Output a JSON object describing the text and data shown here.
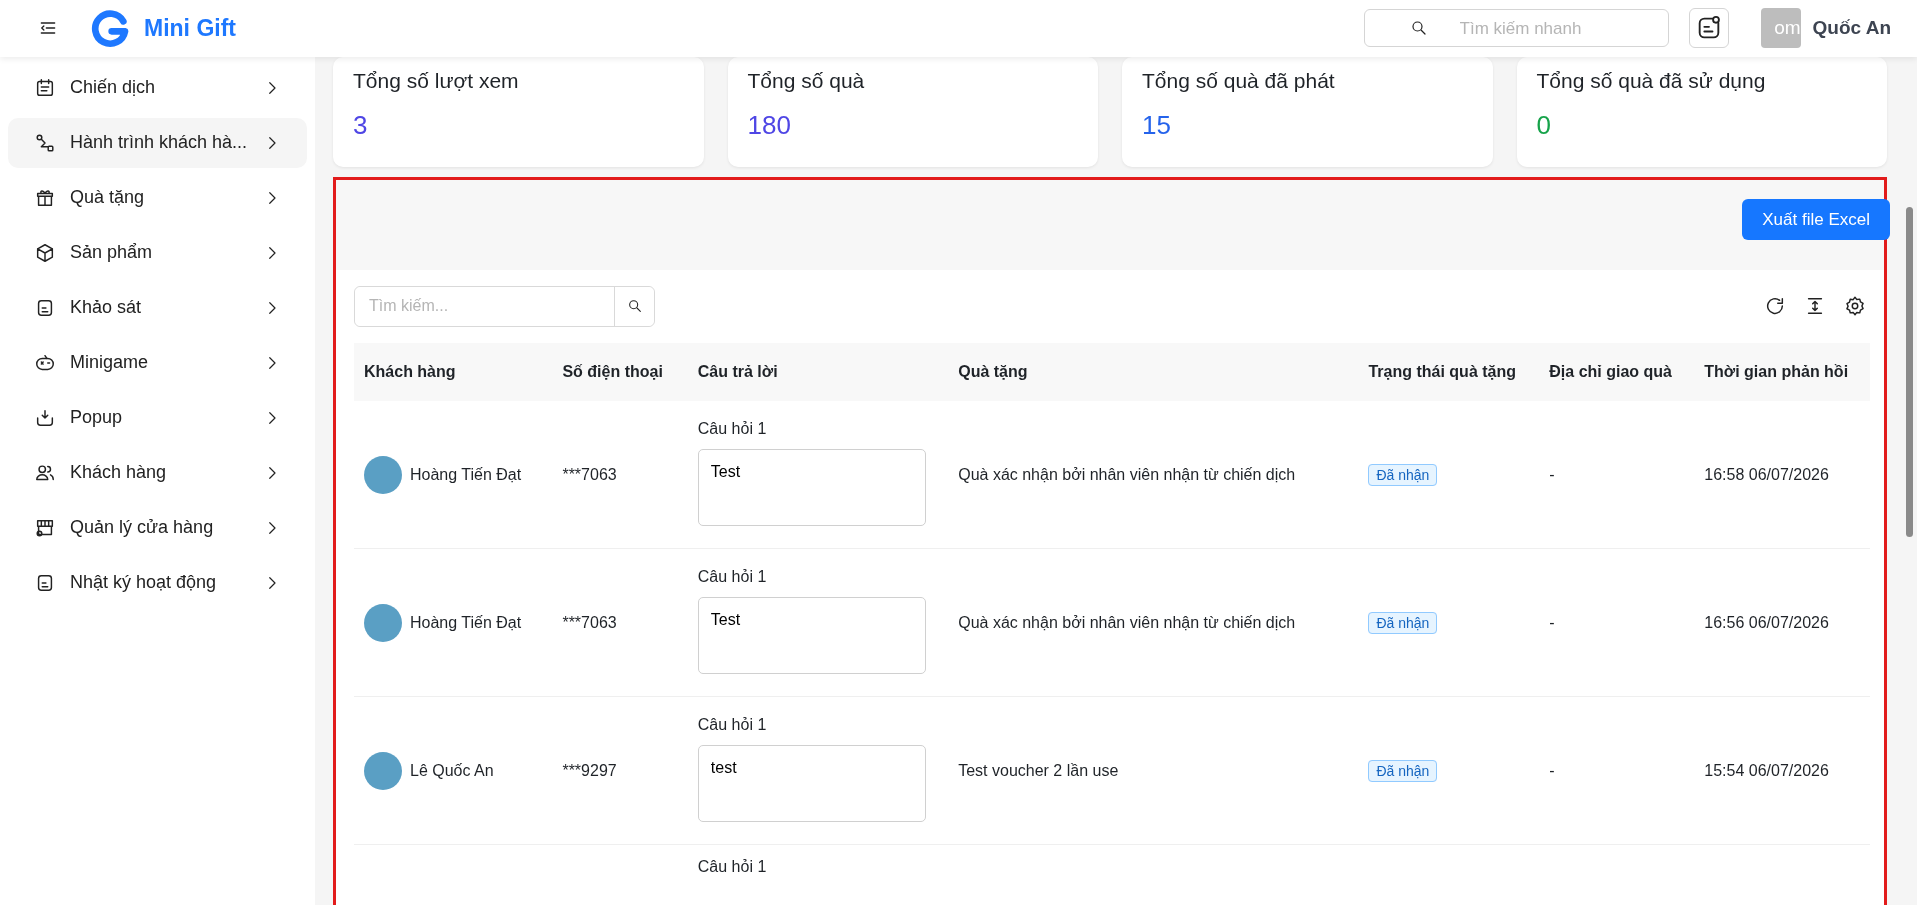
{
  "header": {
    "brand": "Mini Gift",
    "search": {
      "placeholder": "Tìm kiếm nhanh"
    },
    "user": {
      "avatar_text": "om",
      "name": "Quốc An"
    }
  },
  "sidebar": {
    "items": [
      {
        "label": "Chiến dịch",
        "selected": false
      },
      {
        "label": "Hành trình khách hà...",
        "selected": true
      },
      {
        "label": "Quà tặng",
        "selected": false
      },
      {
        "label": "Sản phẩm",
        "selected": false
      },
      {
        "label": "Khảo sát",
        "selected": false
      },
      {
        "label": "Minigame",
        "selected": false
      },
      {
        "label": "Popup",
        "selected": false
      },
      {
        "label": "Khách hàng",
        "selected": false
      },
      {
        "label": "Quản lý cửa hàng",
        "selected": false
      },
      {
        "label": "Nhật ký hoạt động",
        "selected": false
      }
    ]
  },
  "stats": [
    {
      "title": "Tổng số lượt xem",
      "value": "3",
      "color": "#4f46e5"
    },
    {
      "title": "Tổng số quà",
      "value": "180",
      "color": "#4f46e5"
    },
    {
      "title": "Tổng số quà đã phát",
      "value": "15",
      "color": "#2563eb"
    },
    {
      "title": "Tổng số quà đã sử dụng",
      "value": "0",
      "color": "#16a34a"
    }
  ],
  "responses": {
    "highlighted": true,
    "export_button": "Xuất file Excel",
    "search": {
      "placeholder": "Tìm kiếm..."
    },
    "table": {
      "columns": [
        "Khách hàng",
        "Số điện thoại",
        "Câu trả lời",
        "Quà tặng",
        "Trạng thái quà tặng",
        "Địa chỉ giao quà",
        "Thời gian phản hồi"
      ],
      "rows": [
        {
          "customer": "Hoàng Tiến Đạt",
          "phone": "***7063",
          "question": "Câu hỏi 1",
          "answer": "Test",
          "gift": "Quà xác nhận bởi nhân viên nhận từ chiến dịch",
          "status": "Đã nhận",
          "address": "-",
          "time": "16:58 06/07/2026"
        },
        {
          "customer": "Hoàng Tiến Đạt",
          "phone": "***7063",
          "question": "Câu hỏi 1",
          "answer": "Test",
          "gift": "Quà xác nhận bởi nhân viên nhận từ chiến dịch",
          "status": "Đã nhận",
          "address": "-",
          "time": "16:56 06/07/2026"
        },
        {
          "customer": "Lê Quốc An",
          "phone": "***9297",
          "question": "Câu hỏi 1",
          "answer": "test",
          "gift": "Test voucher 2 lần use",
          "status": "Đã nhận",
          "address": "-",
          "time": "15:54 06/07/2026"
        },
        {
          "question": "Câu hỏi 1"
        }
      ]
    }
  }
}
